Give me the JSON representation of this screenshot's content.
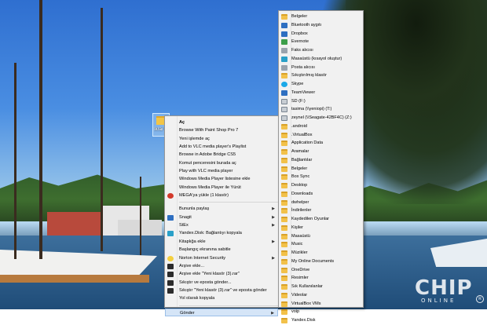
{
  "desktop": {
    "icon_label": "İkrai"
  },
  "context_menu": {
    "items": [
      {
        "label": "Aç",
        "bold": true,
        "icon": "",
        "arrow": false
      },
      {
        "label": "Browse With Paint Shop Pro 7",
        "icon": "",
        "arrow": false
      },
      {
        "label": "Yeni işlemde aç",
        "icon": "",
        "arrow": false
      },
      {
        "label": "Add to VLC media player's Playlist",
        "icon": "",
        "arrow": false
      },
      {
        "label": "Browse in Adobe Bridge CS5",
        "icon": "",
        "arrow": false
      },
      {
        "label": "Komut penceresini burada aç",
        "icon": "",
        "arrow": false
      },
      {
        "label": "Play with VLC media player",
        "icon": "",
        "arrow": false
      },
      {
        "label": "Windows Media Player listesine ekle",
        "icon": "",
        "arrow": false
      },
      {
        "label": "Windows Media Player ile Yürüt",
        "icon": "",
        "arrow": false
      },
      {
        "label": "MEGA'ya yükle (1 klasör)",
        "icon": "mega-icon",
        "arrow": false
      },
      {
        "sep": true
      },
      {
        "label": "Bununla paylaş",
        "icon": "",
        "arrow": true
      },
      {
        "label": "Snagit",
        "icon": "snagit-icon",
        "arrow": true
      },
      {
        "label": "StEx",
        "icon": "",
        "arrow": true
      },
      {
        "label": "Yandex.Disk: Bağlantıyı kopyala",
        "icon": "yandex-disk-icon",
        "arrow": false
      },
      {
        "label": "Kitaplığa ekle",
        "icon": "",
        "arrow": true
      },
      {
        "label": "Başlangıç ekranına sabitle",
        "icon": "",
        "arrow": false
      },
      {
        "label": "Norton Internet Security",
        "icon": "norton-icon",
        "arrow": true
      },
      {
        "label": "Arşive ekle...",
        "icon": "winrar-icon",
        "arrow": false
      },
      {
        "label": "Arşive ekle \"Yeni klasör (3).rar\"",
        "icon": "winrar-icon",
        "arrow": false
      },
      {
        "label": "Sıkıştır ve eposta gönder...",
        "icon": "winrar-icon",
        "arrow": false
      },
      {
        "label": "Sıkıştır \"Yeni klasör (3).rar\" ve eposta gönder",
        "icon": "winrar-icon",
        "arrow": false
      },
      {
        "label": "Yol olarak kopyala",
        "icon": "",
        "arrow": false
      },
      {
        "sep": true
      },
      {
        "label": "Gönder",
        "icon": "",
        "arrow": true,
        "highlight": true
      }
    ]
  },
  "send_to_menu": {
    "items": [
      {
        "label": "Belgeler",
        "icon": "folder"
      },
      {
        "label": "Bluetooth aygıtı",
        "icon": "bluetooth"
      },
      {
        "label": "Dropbox",
        "icon": "dropbox"
      },
      {
        "label": "Evernote",
        "icon": "evernote"
      },
      {
        "label": "Faks alıcısı",
        "icon": "fax"
      },
      {
        "label": "Masaüstü (kısayol oluştur)",
        "icon": "desktop"
      },
      {
        "label": "Posta alıcısı",
        "icon": "mail"
      },
      {
        "label": "Sıkıştırılmış klasör",
        "icon": "zip"
      },
      {
        "label": "Skype",
        "icon": "skype"
      },
      {
        "label": "TeamViewer",
        "icon": "teamviewer"
      },
      {
        "label": "SD (F:)",
        "icon": "drive"
      },
      {
        "label": "tasima (\\\\yeniopi) (T:)",
        "icon": "drive"
      },
      {
        "label": "zeynel (\\\\Seagate-42BF4C) (Z:)",
        "icon": "drive"
      },
      {
        "label": ".android",
        "icon": "folder"
      },
      {
        "label": ".VirtualBox",
        "icon": "folder"
      },
      {
        "label": "Application Data",
        "icon": "folder"
      },
      {
        "label": "Aramalar",
        "icon": "folder"
      },
      {
        "label": "Bağlantılar",
        "icon": "folder"
      },
      {
        "label": "Belgeler",
        "icon": "folder"
      },
      {
        "label": "Box Sync",
        "icon": "folder"
      },
      {
        "label": "Desktop",
        "icon": "folder"
      },
      {
        "label": "Downloads",
        "icon": "folder"
      },
      {
        "label": "dwhelper",
        "icon": "folder"
      },
      {
        "label": "İndirilenler",
        "icon": "folder"
      },
      {
        "label": "Kaydedilen Oyunlar",
        "icon": "folder"
      },
      {
        "label": "Kişiler",
        "icon": "folder"
      },
      {
        "label": "Masaüstü",
        "icon": "folder"
      },
      {
        "label": "Music",
        "icon": "folder"
      },
      {
        "label": "Müzikler",
        "icon": "folder"
      },
      {
        "label": "My Online Documents",
        "icon": "folder"
      },
      {
        "label": "OneDrive",
        "icon": "folder"
      },
      {
        "label": "Resimler",
        "icon": "folder"
      },
      {
        "label": "Sık Kullanılanlar",
        "icon": "folder"
      },
      {
        "label": "Videolar",
        "icon": "folder"
      },
      {
        "label": "VirtualBox VMs",
        "icon": "folder"
      },
      {
        "label": "voip",
        "icon": "folder"
      },
      {
        "label": "Yandex.Disk",
        "icon": "folder"
      }
    ]
  },
  "watermark": {
    "brand": "CHIP",
    "sub": "ONLINE",
    "tm": "R"
  }
}
